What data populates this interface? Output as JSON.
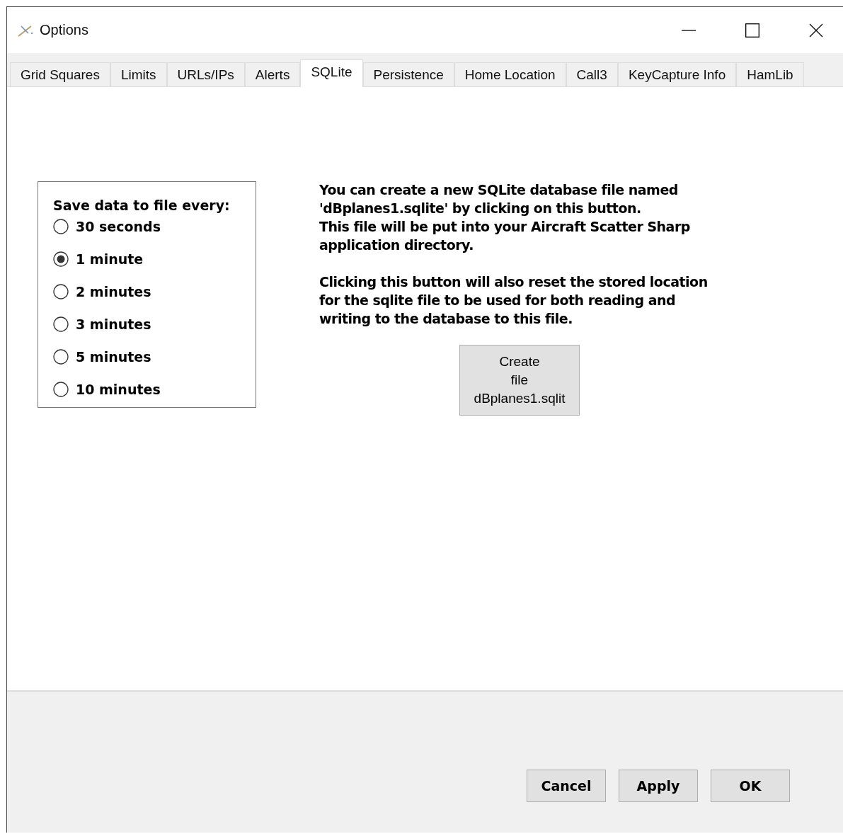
{
  "window": {
    "title": "Options"
  },
  "tabs": [
    {
      "label": "Grid Squares",
      "selected": false
    },
    {
      "label": "Limits",
      "selected": false
    },
    {
      "label": "URLs/IPs",
      "selected": false
    },
    {
      "label": "Alerts",
      "selected": false
    },
    {
      "label": "SQLite",
      "selected": true
    },
    {
      "label": "Persistence",
      "selected": false
    },
    {
      "label": "Home Location",
      "selected": false
    },
    {
      "label": "Call3",
      "selected": false
    },
    {
      "label": "KeyCapture Info",
      "selected": false
    },
    {
      "label": "HamLib",
      "selected": false
    }
  ],
  "save_group": {
    "title": "Save data to file every:",
    "options": [
      {
        "label": "30 seconds",
        "selected": false
      },
      {
        "label": "1 minute",
        "selected": true
      },
      {
        "label": "2 minutes",
        "selected": false
      },
      {
        "label": "3 minutes",
        "selected": false
      },
      {
        "label": "5 minutes",
        "selected": false
      },
      {
        "label": "10 minutes",
        "selected": false
      }
    ]
  },
  "description": [
    [
      "You can create a new SQLite database file named",
      "'dBplanes1.sqlite' by clicking on this button.",
      "This file will be put into your Aircraft Scatter Sharp",
      "application directory."
    ],
    [
      "Clicking this button will also reset the stored location",
      "for the sqlite file to be used for both reading and",
      "writing to the database to this file."
    ]
  ],
  "create_button": [
    "Create",
    "file",
    "dBplanes1.sqlit"
  ],
  "buttons": [
    "Cancel",
    "Apply",
    "OK"
  ]
}
